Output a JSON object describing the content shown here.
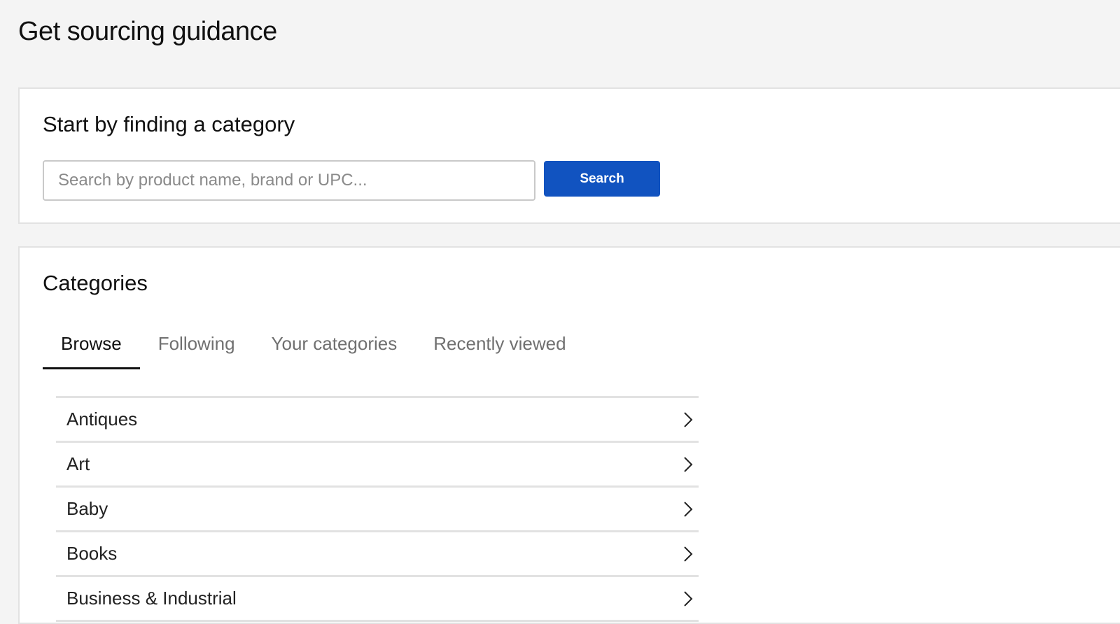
{
  "page": {
    "title": "Get sourcing guidance"
  },
  "search_section": {
    "heading": "Start by finding a category",
    "input_placeholder": "Search by product name, brand or UPC...",
    "input_value": "",
    "button_label": "Search",
    "button_color": "#1153c0"
  },
  "categories_section": {
    "heading": "Categories",
    "tabs": [
      {
        "label": "Browse",
        "active": true
      },
      {
        "label": "Following",
        "active": false
      },
      {
        "label": "Your categories",
        "active": false
      },
      {
        "label": "Recently viewed",
        "active": false
      }
    ],
    "items": [
      {
        "label": "Antiques",
        "icon": "chevron-right-icon"
      },
      {
        "label": "Art",
        "icon": "chevron-right-icon"
      },
      {
        "label": "Baby",
        "icon": "chevron-right-icon"
      },
      {
        "label": "Books",
        "icon": "chevron-right-icon"
      },
      {
        "label": "Business & Industrial",
        "icon": "chevron-right-icon"
      }
    ]
  }
}
